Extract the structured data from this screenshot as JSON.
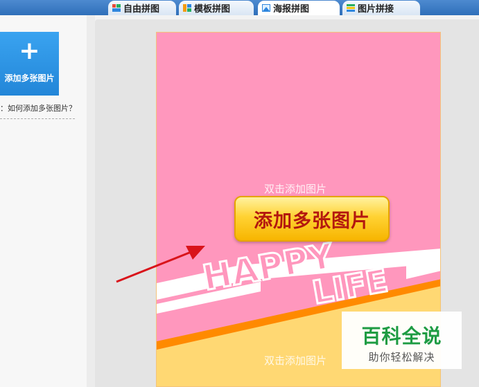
{
  "tabs": [
    {
      "label": "自由拼图",
      "icon": "free-collage-icon",
      "active": false
    },
    {
      "label": "模板拼图",
      "icon": "template-collage-icon",
      "active": false
    },
    {
      "label": "海报拼图",
      "icon": "poster-collage-icon",
      "active": true
    },
    {
      "label": "图片拼接",
      "icon": "image-stitch-icon",
      "active": false
    }
  ],
  "sidebar": {
    "add_button_symbol": "+",
    "add_button_label": "添加多张图片",
    "help_link": "：如何添加多张图片？"
  },
  "poster": {
    "hint_top": "双击添加图片",
    "hint_bottom": "双击添加图片",
    "banner_text_1": "HAPPY",
    "banner_text_2": "LIFE",
    "background_color": "#ff97bd",
    "bottom_color": "#ffd873",
    "stripe_color": "#ff8a00"
  },
  "callout": {
    "label": "添加多张图片",
    "arrow_color": "#d9141b"
  },
  "watermark": {
    "title": "百科全说",
    "subtitle": "助你轻松解决"
  },
  "colors": {
    "accent": "#2286d8",
    "tab_bar": "#2f6fb9"
  }
}
